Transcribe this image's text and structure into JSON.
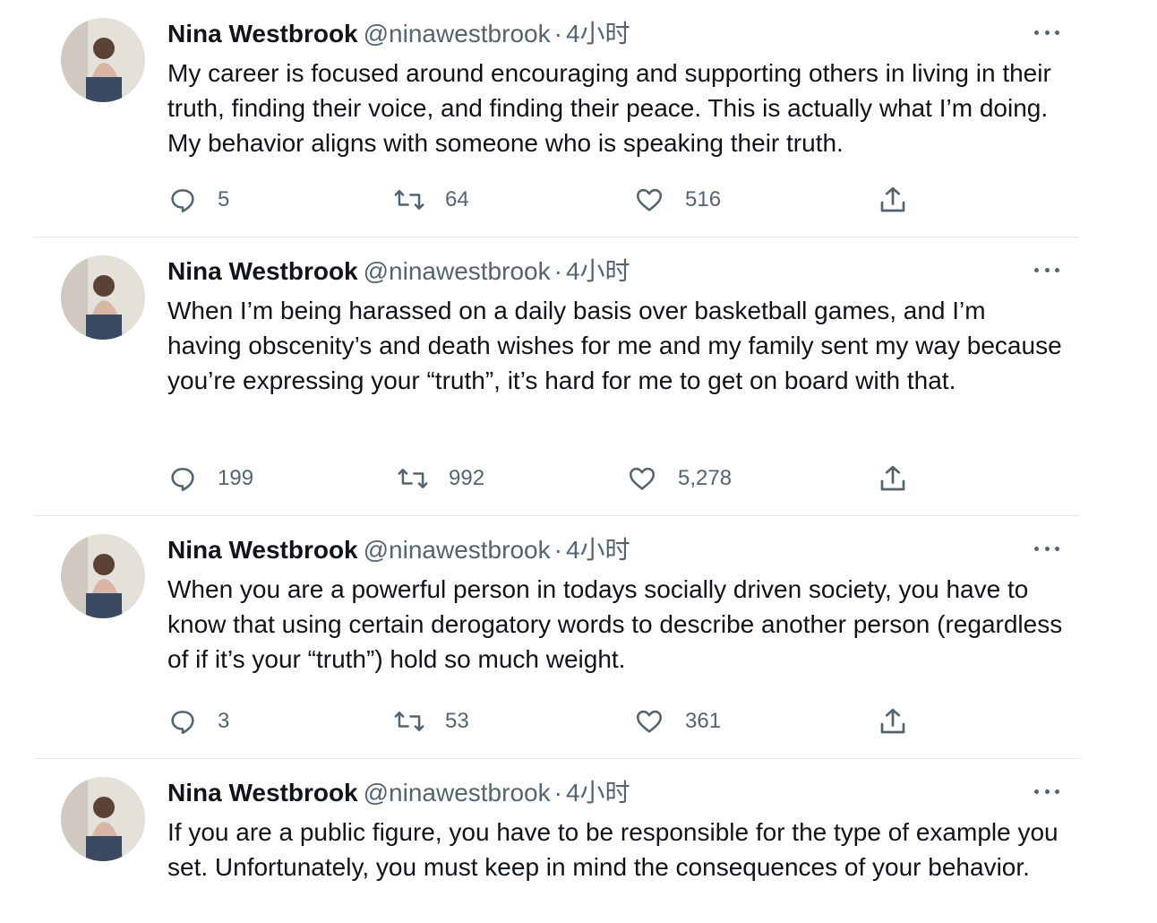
{
  "colors": {
    "text": "#0f1419",
    "secondary": "#536471",
    "divider": "#e6e9eb"
  },
  "icons": {
    "reply": "comment-bubble-icon",
    "retweet": "retweet-arrows-icon",
    "like": "heart-icon",
    "share": "share-upload-icon",
    "more": "more-dots-icon"
  },
  "tweets": [
    {
      "name": "Nina Westbrook",
      "handle": "@ninawestbrook",
      "separator": "·",
      "time": "4小时",
      "text": "My career is focused around encouraging and supporting others in living in their truth, finding their voice, and finding their peace. This is actually what I’m doing. My behavior aligns with someone who is speaking their truth.",
      "replies": "5",
      "retweets": "64",
      "likes": "516"
    },
    {
      "name": "Nina Westbrook",
      "handle": "@ninawestbrook",
      "separator": "·",
      "time": "4小时",
      "text": "When I’m being harassed on a daily basis over basketball games, and I’m having obscenity’s and death wishes for me and my family sent my way because you’re expressing your “truth”, it’s hard for me to get on board with that.",
      "replies": "199",
      "retweets": "992",
      "likes": "5,278"
    },
    {
      "name": "Nina Westbrook",
      "handle": "@ninawestbrook",
      "separator": "·",
      "time": "4小时",
      "text": "When you are a powerful person in todays socially driven society, you have to know that using certain derogatory words to describe another person (regardless of if it’s your “truth”) hold so much weight.",
      "replies": "3",
      "retweets": "53",
      "likes": "361"
    },
    {
      "name": "Nina Westbrook",
      "handle": "@ninawestbrook",
      "separator": "·",
      "time": "4小时",
      "text": "If you are a public figure, you have to be responsible for the type of example you set. Unfortunately, you must keep in mind the consequences of your behavior."
    }
  ]
}
